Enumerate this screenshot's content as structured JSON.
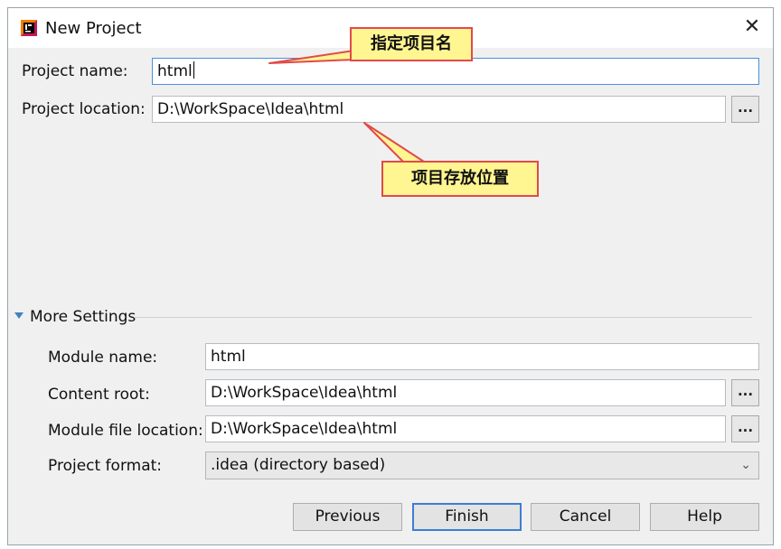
{
  "window": {
    "title": "New Project",
    "app_icon": "intellij-idea-icon",
    "close_glyph": "✕"
  },
  "form": {
    "project_name_label": "Project name:",
    "project_name_value": "html",
    "project_location_label": "Project location:",
    "project_location_value": "D:\\WorkSpace\\Idea\\html",
    "browse_label": "...",
    "more_settings_label": "More Settings"
  },
  "more_settings": {
    "module_name_label": "Module name:",
    "module_name_value": "html",
    "content_root_label": "Content root:",
    "content_root_value": "D:\\WorkSpace\\Idea\\html",
    "module_file_location_label": "Module file location:",
    "module_file_location_value": "D:\\WorkSpace\\Idea\\html",
    "project_format_label": "Project format:",
    "project_format_value": ".idea (directory based)"
  },
  "buttons": {
    "previous": "Previous",
    "finish": "Finish",
    "cancel": "Cancel",
    "help": "Help"
  },
  "annotations": {
    "name_callout": "指定项目名",
    "location_callout": "项目存放位置"
  },
  "colors": {
    "callout_fill": "#fff591",
    "callout_border": "#e24a4a",
    "focus_border": "#4a8fdf"
  }
}
